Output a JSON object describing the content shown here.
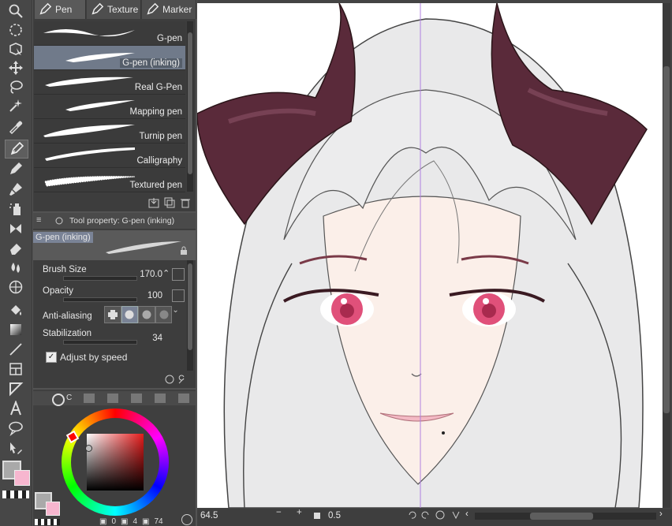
{
  "brush_tabs": [
    {
      "label": "Pen"
    },
    {
      "label": "Texture"
    },
    {
      "label": "Marker"
    }
  ],
  "brushes": [
    {
      "name": "G-pen"
    },
    {
      "name": "G-pen (inking)"
    },
    {
      "name": "Real G-Pen"
    },
    {
      "name": "Mapping pen"
    },
    {
      "name": "Turnip pen"
    },
    {
      "name": "Calligraphy"
    },
    {
      "name": "Textured pen"
    }
  ],
  "tool_property": {
    "title": "Tool property: G-pen (inking)",
    "preset_name": "G-pen (inking)",
    "brush_size_label": "Brush Size",
    "brush_size_value": "170.0",
    "opacity_label": "Opacity",
    "opacity_value": "100",
    "antialias_label": "Anti-aliasing",
    "stabilization_label": "Stabilization",
    "stabilization_value": "34",
    "adjust_label": "Adjust by speed"
  },
  "color_panel": {
    "tab_label": "C",
    "main_color": "#a9a9a9",
    "sub_color": "#f7b6cf"
  },
  "layer_counts": {
    "a": "0",
    "b": "4",
    "c": "74"
  },
  "status": {
    "zoom": "64.5",
    "stroke_size": "0.5"
  },
  "colors": {
    "accent": "#7a8396",
    "hair": "#e9e9ea",
    "horn": "#5a2a3a",
    "eye": "#e0507a",
    "skin": "#fbefe9"
  }
}
